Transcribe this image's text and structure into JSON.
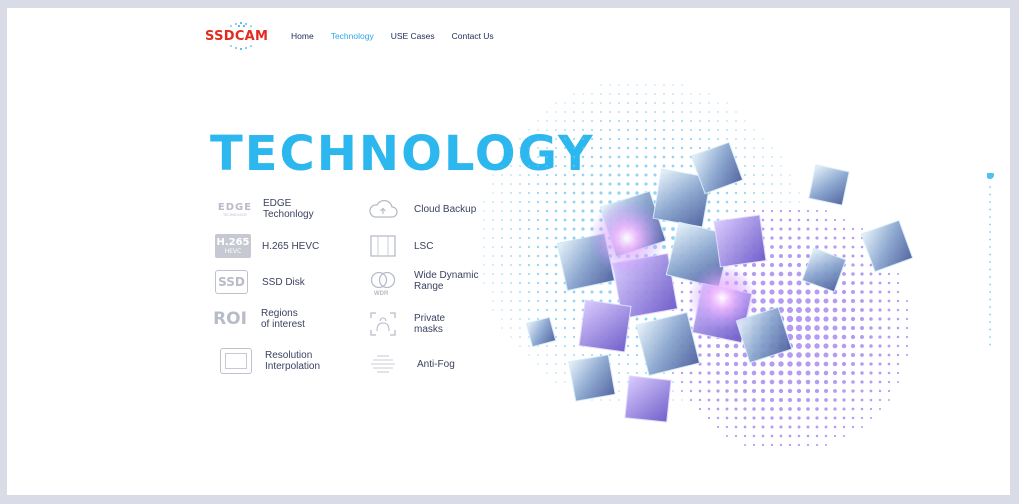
{
  "nav": {
    "logo_text": "SSDCAM",
    "items": [
      {
        "label": "Home"
      },
      {
        "label": "Technology",
        "active": true
      },
      {
        "label": "USE Cases"
      },
      {
        "label": "Contact Us"
      }
    ]
  },
  "hero": {
    "title": "TECHNOLOGY"
  },
  "features": {
    "left": [
      {
        "icon": "edge-icon",
        "icon_text": "EDGE",
        "icon_subtext": "TECHNOLOGY",
        "label_l1": "EDGE",
        "label_l2": "Techonlogy"
      },
      {
        "icon": "h265-icon",
        "icon_text": "H.265",
        "icon_subtext": "HEVC",
        "label_l1": "H.265 HEVC",
        "label_l2": ""
      },
      {
        "icon": "ssd-icon",
        "icon_text": "SSD",
        "label_l1": "SSD Disk",
        "label_l2": ""
      },
      {
        "icon": "roi-icon",
        "icon_text": "ROI",
        "label_l1": "Regions",
        "label_l2": "of interest"
      },
      {
        "icon": "resolution-icon",
        "label_l1": "Resolution",
        "label_l2": "Interpolation"
      }
    ],
    "right": [
      {
        "icon": "cloud-icon",
        "label_l1": "Cloud Backup",
        "label_l2": ""
      },
      {
        "icon": "lsc-icon",
        "label_l1": "LSC",
        "label_l2": ""
      },
      {
        "icon": "wdr-icon",
        "icon_text": "WDR",
        "label_l1": "Wide Dynamic",
        "label_l2": "Range"
      },
      {
        "icon": "private-mask-icon",
        "label_l1": "Private",
        "label_l2": "masks"
      },
      {
        "icon": "anti-fog-icon",
        "label_l1": "Anti-Fog",
        "label_l2": ""
      }
    ]
  },
  "colors": {
    "accent": "#2cb7ee",
    "brand": "#e32a1f",
    "nav_text": "#1e2a5a",
    "purple": "#8a63e8"
  }
}
